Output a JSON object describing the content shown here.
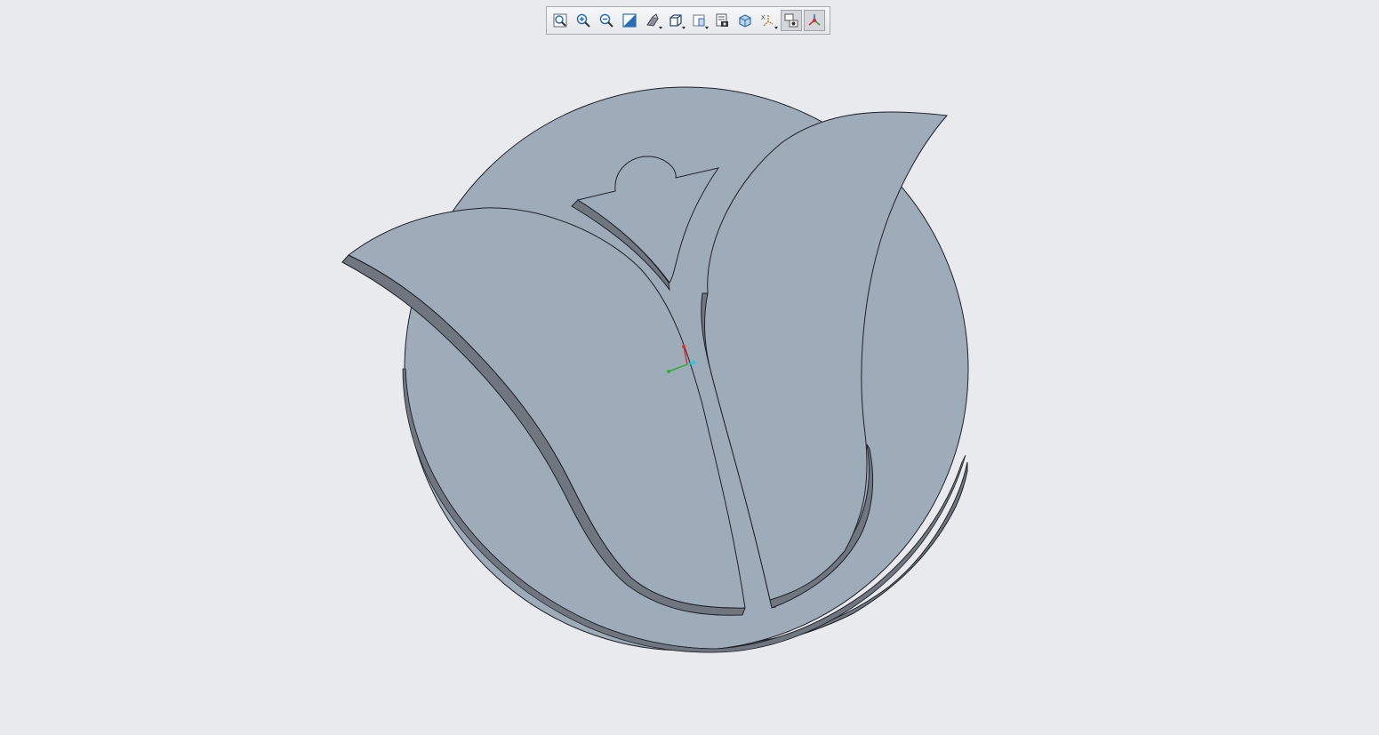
{
  "viewport": {
    "background": "#e8eaed",
    "model_color": "#9eabb9",
    "model_side_color": "#6f7680",
    "edge_color": "#1f2328"
  },
  "toolbar": {
    "buttons": [
      {
        "name": "refit-icon",
        "active": false
      },
      {
        "name": "zoom-in-icon",
        "active": false
      },
      {
        "name": "zoom-out-icon",
        "active": false
      },
      {
        "name": "repaint-icon",
        "active": false
      },
      {
        "name": "perspective-icon",
        "active": false,
        "dropdown": true
      },
      {
        "name": "display-style-icon",
        "active": false,
        "dropdown": true
      },
      {
        "name": "saved-views-icon",
        "active": false,
        "dropdown": true
      },
      {
        "name": "view-manager-icon",
        "active": false
      },
      {
        "name": "section-icon",
        "active": false
      },
      {
        "name": "datum-display-icon",
        "active": false,
        "dropdown": true
      },
      {
        "name": "annotation-display-icon",
        "active": true
      },
      {
        "name": "spin-center-icon",
        "active": true
      }
    ]
  }
}
